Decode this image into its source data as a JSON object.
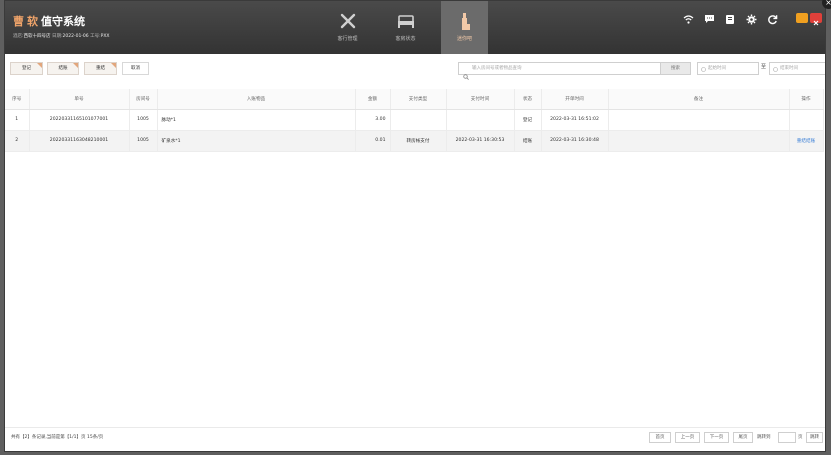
{
  "header": {
    "brand_prefix": "曹",
    "brand_mid": "软",
    "brand_rest": "值守系统",
    "shop_label": "酒店:",
    "shop_name": "西软十四号店",
    "date_label": "日期:",
    "date_value": "2022-01-06",
    "shift_label": "工号:",
    "shift_value": "PXX"
  },
  "nav": {
    "tabs": [
      {
        "label": "客行管理",
        "icon": "tools-icon"
      },
      {
        "label": "客房状态",
        "icon": "bed-icon"
      },
      {
        "label": "迷你吧",
        "icon": "bottle-icon"
      }
    ],
    "active": 2
  },
  "top_icons": [
    "wifi-icon",
    "chat-icon",
    "notebook-icon",
    "gear-icon",
    "refresh-icon"
  ],
  "window_colors": {
    "minimize": "#f0a020",
    "close": "#e0403a",
    "accent": "#e2a67c"
  },
  "toolbar": {
    "buttons": [
      "登记",
      "结账",
      "重结",
      "取消"
    ],
    "search_placeholder": "输入房间号或者物品查询",
    "search_button": "搜索",
    "start_placeholder": "起始时间",
    "end_placeholder": "结束时间",
    "date_separator": "至"
  },
  "table": {
    "columns": [
      "序号",
      "单号",
      "房间号",
      "入账物品",
      "金额",
      "支付类型",
      "支付时间",
      "状态",
      "开单时间",
      "备注",
      "操作"
    ],
    "rows": [
      {
        "idx": "1",
        "order": "20220331165101077001",
        "room": "1005",
        "items": "脉动*1",
        "amount": "3.00",
        "pay_type": "",
        "pay_time": "",
        "status": "登记",
        "open_time": "2022-03-31 16:51:02",
        "note": "",
        "action": ""
      },
      {
        "idx": "2",
        "order": "20220331163048210001",
        "room": "1005",
        "items": "矿泉水*1",
        "amount": "0.01",
        "pay_type": "转房帐支付",
        "pay_time": "2022-03-31 16:30:53",
        "status": "结账",
        "open_time": "2022-03-31 16:30:48",
        "note": "",
        "action": "重结结账"
      }
    ]
  },
  "footer": {
    "summary": "共有【2】条记录,当前是第【1/1】页  15条/页",
    "first": "首页",
    "prev": "上一页",
    "next": "下一页",
    "last": "尾页",
    "jump_label": "跳转到",
    "page_unit": "页",
    "go": "跳转"
  }
}
